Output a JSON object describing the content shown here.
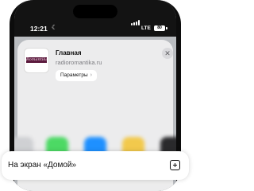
{
  "status_bar": {
    "time": "12:21",
    "network": "LTE",
    "battery": "80"
  },
  "share_sheet": {
    "site_logo_text": "Romantika",
    "page_title": "Главная",
    "page_url": "radioromantika.ru",
    "options_label": "Параметры",
    "options_chevron": "›",
    "close_glyph": "✕"
  },
  "app_row": {
    "icons": [
      "blurred-app-icon",
      "messages-icon",
      "mail-icon",
      "notes-icon",
      "app-icon"
    ],
    "colors": [
      "#cfd0d3",
      "#4cd964",
      "#1e90ff",
      "#f2c94c",
      "#2a2a2c"
    ]
  },
  "action": {
    "label": "На экран «Домой»",
    "icon": "add-to-home-icon"
  }
}
